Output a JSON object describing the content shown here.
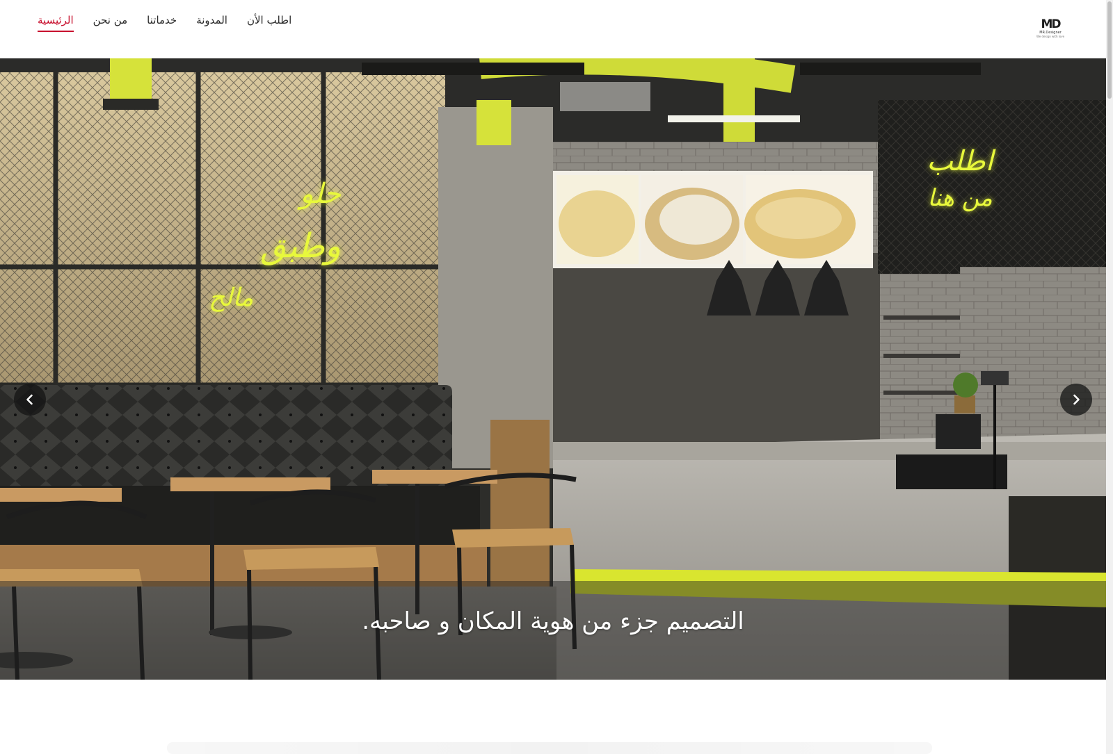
{
  "header": {
    "logo": {
      "mark": "MD",
      "name": "MR.Designer",
      "tagline": "We design with love"
    },
    "nav": [
      {
        "label": "اطلب الأن"
      },
      {
        "label": "المدونة"
      },
      {
        "label": "خدماتنا"
      },
      {
        "label": "من نحن"
      },
      {
        "label": "الرئيسية",
        "active": true
      }
    ]
  },
  "hero": {
    "caption": "التصميم جزء من هوية المكان و صاحبه.",
    "prev_icon": "chevron-left-icon",
    "next_icon": "chevron-right-icon",
    "signs": {
      "left": [
        "حلو",
        "وطبق",
        "مالح"
      ],
      "right": [
        "اطلب",
        "من هنا"
      ]
    }
  },
  "colors": {
    "accent": "#c8102e",
    "neon": "#e6f53a"
  }
}
